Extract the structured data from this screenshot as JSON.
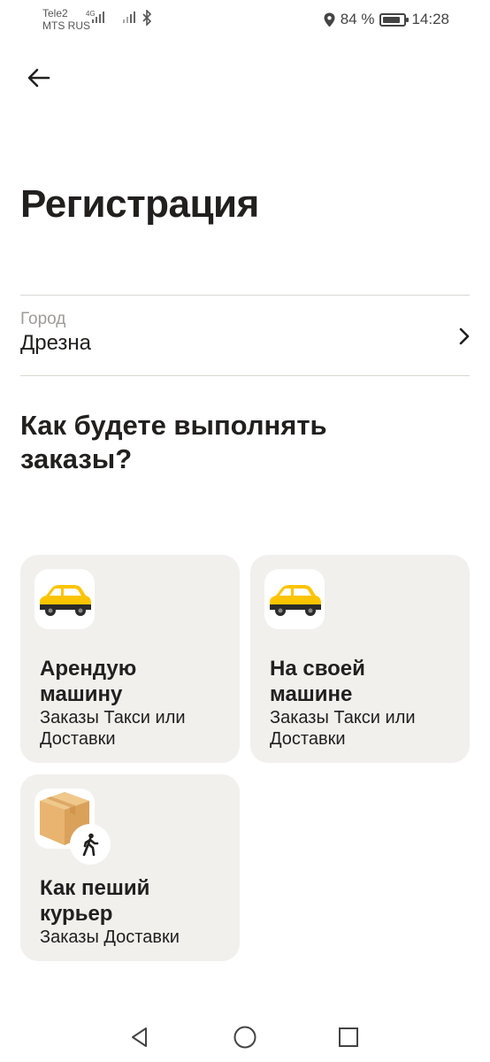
{
  "status_bar": {
    "carrier_1": "Tele2",
    "carrier_2": "MTS RUS",
    "network_type": "4G",
    "battery_percent": "84 %",
    "battery_level": 0.84,
    "time": "14:28",
    "icons": [
      "signal-icon",
      "bluetooth-icon",
      "location-icon",
      "battery-icon"
    ]
  },
  "header": {
    "back_icon": "arrow-left-icon",
    "title": "Регистрация"
  },
  "city": {
    "label": "Город",
    "value": "Дрезна",
    "chevron_icon": "chevron-right-icon"
  },
  "question": "Как будете выполнять заказы?",
  "options": [
    {
      "icon": "taxi-car-icon",
      "title": "Арендую машину",
      "subtitle": "Заказы Такси или Доставки"
    },
    {
      "icon": "taxi-car-icon",
      "title": "На своей машине",
      "subtitle": "Заказы Такси или Доставки"
    },
    {
      "icon": "parcel-box-icon",
      "badge_icon": "walking-person-icon",
      "title": "Как пеший курьер",
      "subtitle": "Заказы Доставки"
    }
  ],
  "nav_bar": {
    "icons": [
      "back-triangle-icon",
      "home-circle-icon",
      "recents-square-icon"
    ]
  },
  "colors": {
    "card_background": "#f1f0ed",
    "car_yellow": "#fcc400",
    "text": "#21201f",
    "secondary_text": "#9e9b98"
  }
}
